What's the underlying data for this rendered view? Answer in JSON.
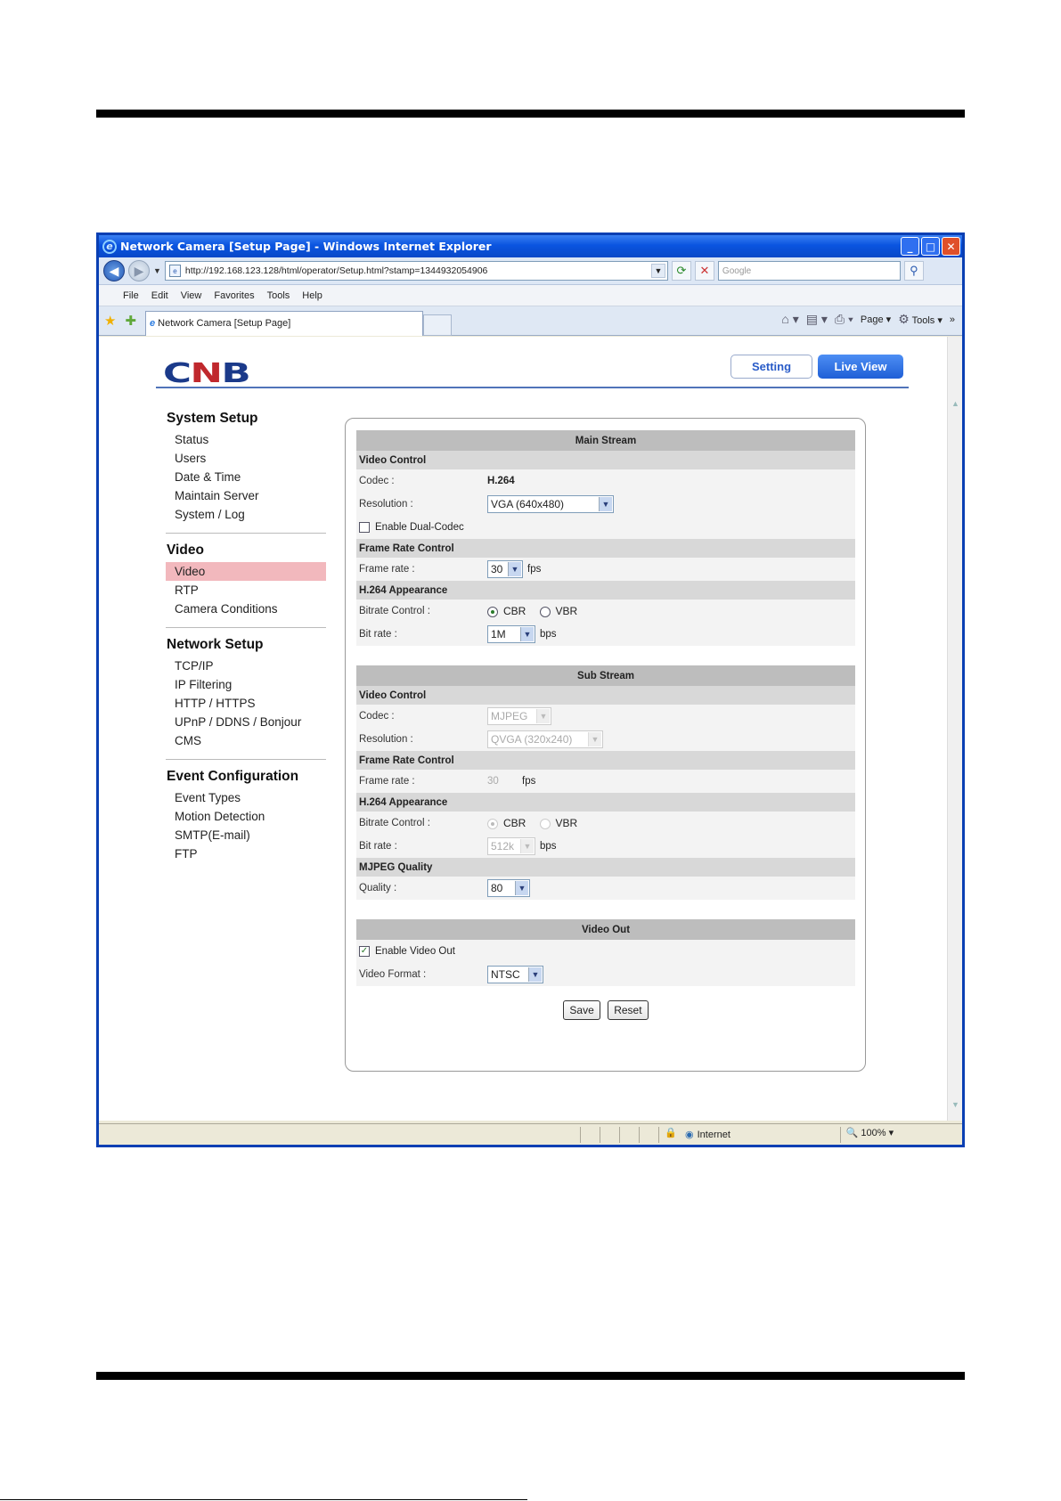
{
  "window": {
    "title": "Network Camera [Setup Page] - Windows Internet Explorer",
    "url": "http://192.168.123.128/html/operator/Setup.html?stamp=1344932054906",
    "search_placeholder": "Google",
    "menu": [
      "File",
      "Edit",
      "View",
      "Favorites",
      "Tools",
      "Help"
    ],
    "tab_title": "Network Camera [Setup Page]",
    "cmd_page": "Page",
    "cmd_tools": "Tools",
    "status_zone": "Internet",
    "zoom": "100%"
  },
  "header": {
    "logo": "CNB",
    "setting_button": "Setting",
    "liveview_button": "Live View"
  },
  "sidebar": [
    {
      "title": "System Setup",
      "items": [
        "Status",
        "Users",
        "Date & Time",
        "Maintain Server",
        "System / Log"
      ]
    },
    {
      "title": "Video",
      "items": [
        "Video",
        "RTP",
        "Camera Conditions"
      ],
      "active": "Video"
    },
    {
      "title": "Network Setup",
      "items": [
        "TCP/IP",
        "IP Filtering",
        "HTTP / HTTPS",
        "UPnP / DDNS / Bonjour",
        "CMS"
      ]
    },
    {
      "title": "Event Configuration",
      "items": [
        "Event Types",
        "Motion Detection",
        "SMTP(E-mail)",
        "FTP"
      ]
    }
  ],
  "main_stream": {
    "title": "Main Stream",
    "video_control": "Video Control",
    "codec_label": "Codec :",
    "codec_value": "H.264",
    "resolution_label": "Resolution :",
    "resolution_value": "VGA (640x480)",
    "dual_codec_label": "Enable Dual-Codec",
    "dual_codec_checked": false,
    "frame_rate_control": "Frame Rate Control",
    "frame_rate_label": "Frame rate :",
    "frame_rate_value": "30",
    "frame_rate_unit": "fps",
    "appearance": "H.264 Appearance",
    "bitrate_control_label": "Bitrate Control :",
    "cbr": "CBR",
    "vbr": "VBR",
    "bitrate_mode": "CBR",
    "bit_rate_label": "Bit rate :",
    "bit_rate_value": "1M",
    "bit_rate_unit": "bps"
  },
  "sub_stream": {
    "title": "Sub Stream",
    "video_control": "Video Control",
    "codec_label": "Codec :",
    "codec_value": "MJPEG",
    "resolution_label": "Resolution :",
    "resolution_value": "QVGA (320x240)",
    "frame_rate_control": "Frame Rate Control",
    "frame_rate_label": "Frame rate :",
    "frame_rate_value": "30",
    "frame_rate_unit": "fps",
    "appearance": "H.264 Appearance",
    "bitrate_control_label": "Bitrate Control :",
    "cbr": "CBR",
    "vbr": "VBR",
    "bitrate_mode": "CBR",
    "bit_rate_label": "Bit rate :",
    "bit_rate_value": "512k",
    "bit_rate_unit": "bps",
    "mjpeg_quality": "MJPEG Quality",
    "quality_label": "Quality :",
    "quality_value": "80"
  },
  "video_out": {
    "title": "Video Out",
    "enable_label": "Enable Video Out",
    "enable_checked": true,
    "format_label": "Video Format :",
    "format_value": "NTSC"
  },
  "actions": {
    "save": "Save",
    "reset": "Reset"
  }
}
